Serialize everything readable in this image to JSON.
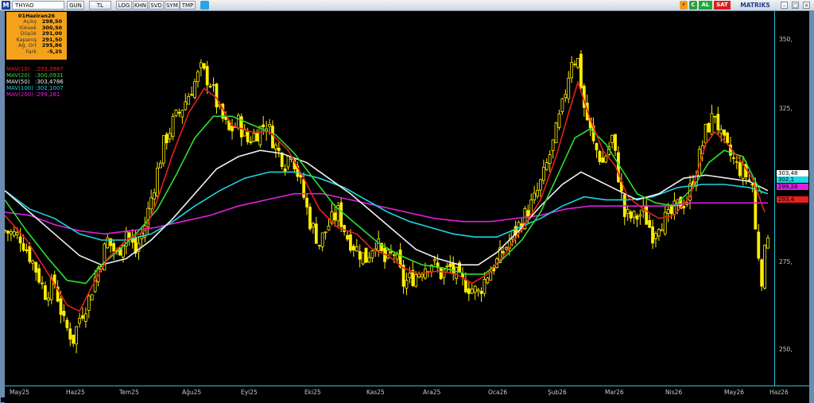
{
  "toolbar": {
    "logo": "M",
    "symbol": "THYAO",
    "buttons": [
      "GUN",
      "TL",
      "LOG",
      "KHN",
      "SVD",
      "SYM",
      "TMP"
    ],
    "al": "AL",
    "sat": "SAT",
    "brand": "MATRIKS",
    "icons": [
      "lightning-icon",
      "twitter-icon",
      "minimize-icon",
      "maximize-icon",
      "close-icon"
    ]
  },
  "info": {
    "date": "01Haziran26",
    "rows": [
      {
        "label": "Açılış",
        "value": "298,50"
      },
      {
        "label": "Yüksek",
        "value": "300,50"
      },
      {
        "label": "Düşük",
        "value": "291,00"
      },
      {
        "label": "Kapanış",
        "value": "291,50"
      },
      {
        "label": "Ağ. Ort",
        "value": "295,86"
      },
      {
        "label": "Fark",
        "value": "-5,25"
      }
    ]
  },
  "legend": [
    {
      "name": "MAV(10)",
      "value": ":293,3987",
      "color": "#e8201e"
    },
    {
      "name": "MAV(20)",
      "value": ":300,0931",
      "color": "#2ee02e"
    },
    {
      "name": "MAV(50)",
      "value": ":303,4786",
      "color": "#f0f0f0"
    },
    {
      "name": "MAV(100)",
      "value": ":302,1007",
      "color": "#1ed5e0"
    },
    {
      "name": "MAV(200)",
      "value": ":299,281",
      "color": "#e020e0"
    }
  ],
  "value_tags": [
    {
      "text": "303,48",
      "bg": "#ffffff",
      "fg": "#000000",
      "price": 303.48
    },
    {
      "text": "302,1",
      "bg": "#1ed5e0",
      "fg": "#000000",
      "price": 302.1
    },
    {
      "text": "299,28",
      "bg": "#e020e0",
      "fg": "#000000",
      "price": 299.28
    },
    {
      "text": "293,4",
      "bg": "#e8201e",
      "fg": "#000000",
      "price": 293.4
    }
  ],
  "chart_data": {
    "type": "candlestick",
    "yaxis": {
      "ticks": [
        350,
        325,
        275,
        250
      ],
      "tick_labels": [
        "350,",
        "325,",
        "275,",
        "250,"
      ],
      "min": 240,
      "max": 361
    },
    "xaxis": {
      "labels": [
        "May25",
        "Haz25",
        "Tem25",
        "Ağu25",
        "Eyl25",
        "Eki25",
        "Kas25",
        "Ara25",
        "Oca26",
        "Şub26",
        "Mar26",
        "Nis26",
        "May26",
        "Haz26"
      ]
    },
    "close_path": [
      [
        0,
        290
      ],
      [
        10,
        288
      ],
      [
        18,
        280
      ],
      [
        26,
        270
      ],
      [
        32,
        273
      ],
      [
        38,
        260
      ],
      [
        44,
        255
      ],
      [
        48,
        262
      ],
      [
        54,
        268
      ],
      [
        60,
        278
      ],
      [
        66,
        287
      ],
      [
        72,
        282
      ],
      [
        78,
        290
      ],
      [
        84,
        283
      ],
      [
        90,
        292
      ],
      [
        96,
        305
      ],
      [
        102,
        318
      ],
      [
        108,
        325
      ],
      [
        114,
        330
      ],
      [
        120,
        336
      ],
      [
        126,
        342
      ],
      [
        132,
        338
      ],
      [
        138,
        328
      ],
      [
        144,
        322
      ],
      [
        150,
        325
      ],
      [
        156,
        319
      ],
      [
        162,
        322
      ],
      [
        168,
        325
      ],
      [
        174,
        317
      ],
      [
        180,
        312
      ],
      [
        184,
        316
      ],
      [
        190,
        305
      ],
      [
        196,
        293
      ],
      [
        202,
        286
      ],
      [
        208,
        292
      ],
      [
        214,
        296
      ],
      [
        220,
        288
      ],
      [
        226,
        284
      ],
      [
        232,
        281
      ],
      [
        238,
        287
      ],
      [
        244,
        280
      ],
      [
        250,
        283
      ],
      [
        256,
        273
      ],
      [
        262,
        275
      ],
      [
        268,
        278
      ],
      [
        274,
        280
      ],
      [
        280,
        276
      ],
      [
        286,
        278
      ],
      [
        292,
        274
      ],
      [
        298,
        272
      ],
      [
        304,
        270
      ],
      [
        310,
        276
      ],
      [
        316,
        280
      ],
      [
        322,
        285
      ],
      [
        328,
        290
      ],
      [
        334,
        295
      ],
      [
        340,
        300
      ],
      [
        346,
        308
      ],
      [
        352,
        318
      ],
      [
        358,
        330
      ],
      [
        364,
        346
      ],
      [
        368,
        345
      ],
      [
        372,
        330
      ],
      [
        378,
        318
      ],
      [
        384,
        312
      ],
      [
        390,
        320
      ],
      [
        394,
        308
      ],
      [
        398,
        295
      ],
      [
        404,
        294
      ],
      [
        410,
        296
      ],
      [
        416,
        289
      ],
      [
        420,
        293
      ],
      [
        426,
        294
      ],
      [
        432,
        298
      ],
      [
        438,
        300
      ],
      [
        444,
        310
      ],
      [
        450,
        322
      ],
      [
        456,
        328
      ],
      [
        460,
        320
      ],
      [
        464,
        316
      ],
      [
        470,
        311
      ],
      [
        476,
        308
      ],
      [
        480,
        305
      ],
      [
        482,
        290
      ],
      [
        486,
        275
      ],
      [
        490,
        290
      ]
    ],
    "mav10": [
      [
        0,
        295
      ],
      [
        14,
        287
      ],
      [
        28,
        276
      ],
      [
        40,
        266
      ],
      [
        48,
        264
      ],
      [
        56,
        272
      ],
      [
        66,
        281
      ],
      [
        78,
        287
      ],
      [
        90,
        290
      ],
      [
        98,
        300
      ],
      [
        108,
        315
      ],
      [
        118,
        328
      ],
      [
        128,
        336
      ],
      [
        136,
        333
      ],
      [
        146,
        324
      ],
      [
        158,
        322
      ],
      [
        170,
        322
      ],
      [
        182,
        316
      ],
      [
        192,
        307
      ],
      [
        202,
        297
      ],
      [
        214,
        291
      ],
      [
        226,
        289
      ],
      [
        236,
        284
      ],
      [
        246,
        282
      ],
      [
        256,
        278
      ],
      [
        266,
        276
      ],
      [
        278,
        277
      ],
      [
        290,
        276
      ],
      [
        300,
        273
      ],
      [
        310,
        276
      ],
      [
        322,
        283
      ],
      [
        334,
        292
      ],
      [
        344,
        300
      ],
      [
        354,
        314
      ],
      [
        362,
        328
      ],
      [
        368,
        338
      ],
      [
        376,
        326
      ],
      [
        384,
        316
      ],
      [
        392,
        311
      ],
      [
        400,
        301
      ],
      [
        410,
        297
      ],
      [
        420,
        294
      ],
      [
        430,
        295
      ],
      [
        440,
        301
      ],
      [
        450,
        318
      ],
      [
        456,
        322
      ],
      [
        464,
        318
      ],
      [
        472,
        313
      ],
      [
        480,
        307
      ],
      [
        488,
        296
      ]
    ],
    "mav20": [
      [
        0,
        300
      ],
      [
        14,
        290
      ],
      [
        28,
        281
      ],
      [
        40,
        274
      ],
      [
        52,
        273
      ],
      [
        62,
        279
      ],
      [
        74,
        284
      ],
      [
        86,
        290
      ],
      [
        98,
        297
      ],
      [
        110,
        308
      ],
      [
        122,
        320
      ],
      [
        134,
        327
      ],
      [
        146,
        327
      ],
      [
        160,
        324
      ],
      [
        174,
        321
      ],
      [
        186,
        315
      ],
      [
        198,
        307
      ],
      [
        212,
        298
      ],
      [
        226,
        292
      ],
      [
        240,
        286
      ],
      [
        254,
        282
      ],
      [
        268,
        279
      ],
      [
        282,
        278
      ],
      [
        296,
        276
      ],
      [
        308,
        276
      ],
      [
        320,
        281
      ],
      [
        332,
        287
      ],
      [
        344,
        296
      ],
      [
        356,
        309
      ],
      [
        366,
        320
      ],
      [
        376,
        323
      ],
      [
        386,
        318
      ],
      [
        396,
        310
      ],
      [
        406,
        302
      ],
      [
        418,
        299
      ],
      [
        430,
        298
      ],
      [
        442,
        304
      ],
      [
        452,
        312
      ],
      [
        462,
        316
      ],
      [
        474,
        314
      ],
      [
        486,
        302
      ]
    ],
    "mav50": [
      [
        0,
        303
      ],
      [
        16,
        296
      ],
      [
        32,
        289
      ],
      [
        48,
        282
      ],
      [
        62,
        279
      ],
      [
        78,
        281
      ],
      [
        94,
        287
      ],
      [
        108,
        294
      ],
      [
        122,
        302
      ],
      [
        136,
        310
      ],
      [
        150,
        314
      ],
      [
        164,
        316
      ],
      [
        178,
        315
      ],
      [
        194,
        312
      ],
      [
        208,
        307
      ],
      [
        222,
        302
      ],
      [
        236,
        296
      ],
      [
        250,
        290
      ],
      [
        264,
        284
      ],
      [
        278,
        281
      ],
      [
        292,
        279
      ],
      [
        304,
        279
      ],
      [
        316,
        283
      ],
      [
        330,
        290
      ],
      [
        344,
        298
      ],
      [
        358,
        305
      ],
      [
        370,
        309
      ],
      [
        382,
        306
      ],
      [
        394,
        303
      ],
      [
        406,
        300
      ],
      [
        420,
        302
      ],
      [
        436,
        307
      ],
      [
        450,
        308
      ],
      [
        464,
        307
      ],
      [
        478,
        306
      ],
      [
        490,
        303
      ]
    ],
    "mav100": [
      [
        0,
        303
      ],
      [
        16,
        297
      ],
      [
        32,
        294
      ],
      [
        48,
        289
      ],
      [
        62,
        287
      ],
      [
        78,
        287
      ],
      [
        94,
        289
      ],
      [
        108,
        293
      ],
      [
        122,
        298
      ],
      [
        138,
        303
      ],
      [
        154,
        307
      ],
      [
        170,
        309
      ],
      [
        186,
        309
      ],
      [
        202,
        307
      ],
      [
        218,
        304
      ],
      [
        232,
        300
      ],
      [
        246,
        296
      ],
      [
        260,
        293
      ],
      [
        274,
        291
      ],
      [
        288,
        289
      ],
      [
        302,
        288
      ],
      [
        316,
        288
      ],
      [
        330,
        291
      ],
      [
        344,
        294
      ],
      [
        358,
        298
      ],
      [
        372,
        301
      ],
      [
        386,
        300
      ],
      [
        400,
        300
      ],
      [
        416,
        301
      ],
      [
        432,
        304
      ],
      [
        448,
        305
      ],
      [
        462,
        305
      ],
      [
        478,
        304
      ],
      [
        490,
        302
      ]
    ],
    "mav200": [
      [
        0,
        296
      ],
      [
        16,
        295
      ],
      [
        32,
        292
      ],
      [
        48,
        290
      ],
      [
        64,
        289
      ],
      [
        80,
        290
      ],
      [
        96,
        291
      ],
      [
        114,
        293
      ],
      [
        132,
        295
      ],
      [
        150,
        298
      ],
      [
        168,
        300
      ],
      [
        186,
        302
      ],
      [
        204,
        302
      ],
      [
        222,
        300
      ],
      [
        240,
        298
      ],
      [
        258,
        296
      ],
      [
        276,
        294
      ],
      [
        294,
        293
      ],
      [
        312,
        293
      ],
      [
        328,
        294
      ],
      [
        344,
        295
      ],
      [
        360,
        297
      ],
      [
        376,
        298
      ],
      [
        392,
        298
      ],
      [
        408,
        298
      ],
      [
        424,
        298
      ],
      [
        440,
        299
      ],
      [
        456,
        299
      ],
      [
        472,
        299
      ],
      [
        490,
        299
      ]
    ]
  }
}
